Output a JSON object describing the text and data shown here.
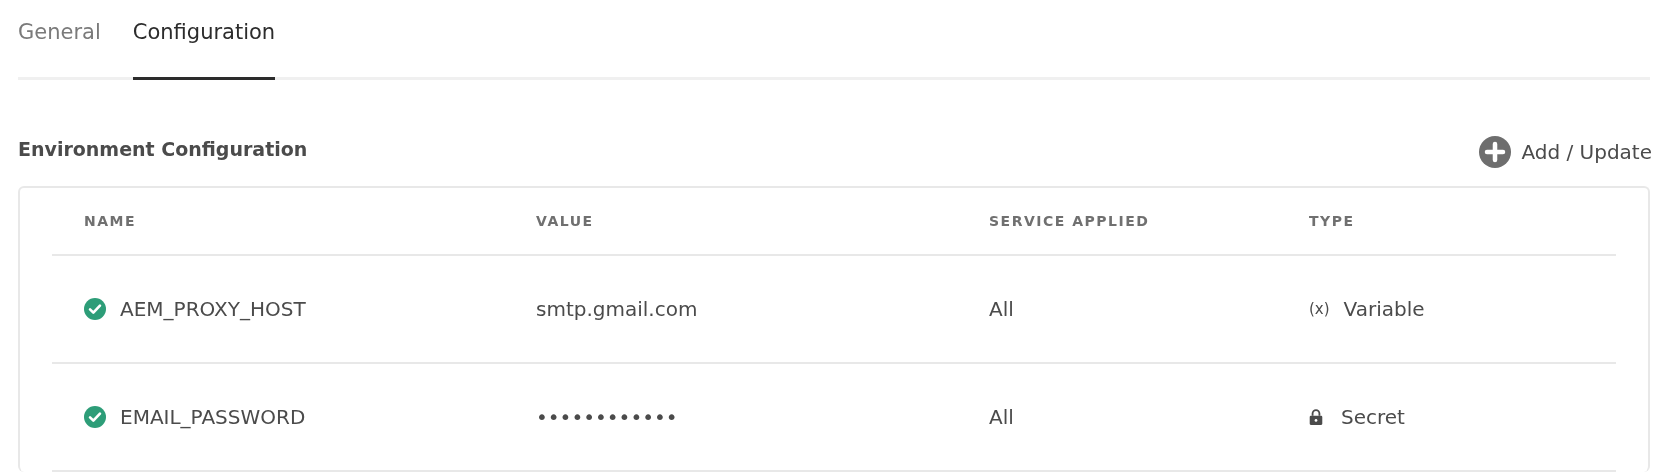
{
  "tabs": [
    {
      "label": "General",
      "selected": false
    },
    {
      "label": "Configuration",
      "selected": true
    }
  ],
  "section": {
    "title": "Environment Configuration",
    "add_button": "Add / Update"
  },
  "table": {
    "columns": [
      "NAME",
      "VALUE",
      "SERVICE APPLIED",
      "TYPE"
    ],
    "rows": [
      {
        "valid": true,
        "name": "AEM_PROXY_HOST",
        "value": "smtp.gmail.com",
        "service": "All",
        "type": {
          "kind": "variable",
          "symbol": "(x)",
          "label": "Variable"
        }
      },
      {
        "valid": true,
        "name": "EMAIL_PASSWORD",
        "value": "••••••••••••",
        "service": "All",
        "type": {
          "kind": "secret",
          "label": "Secret"
        }
      }
    ]
  }
}
